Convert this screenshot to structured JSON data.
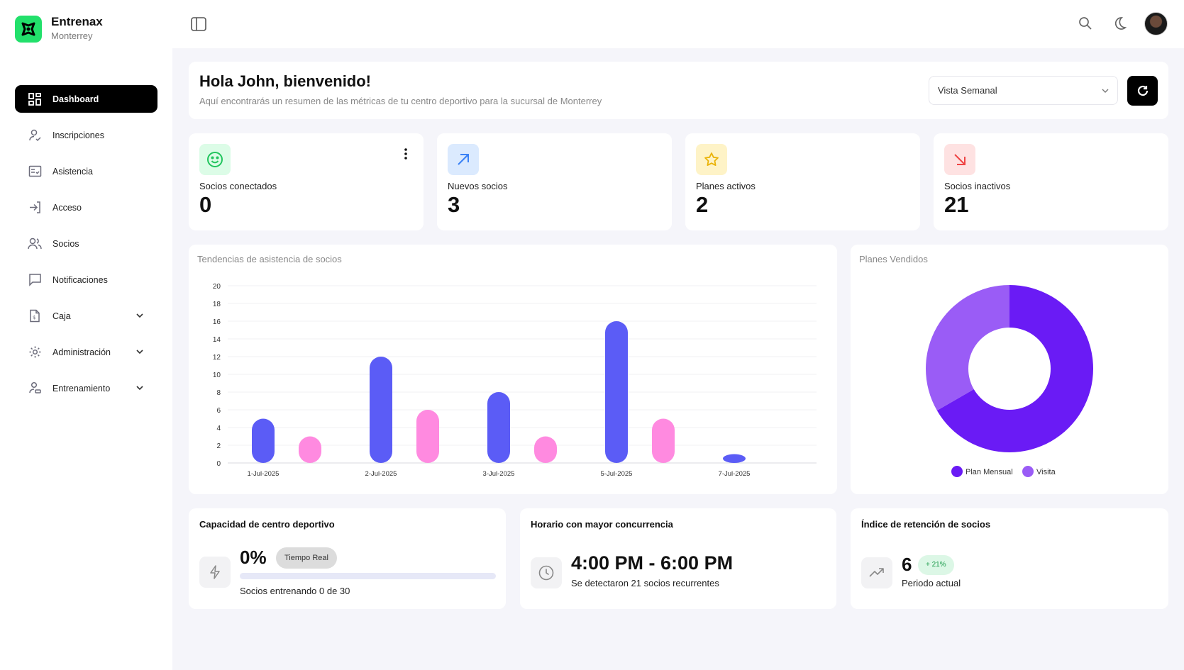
{
  "brand": {
    "name": "Entrenax",
    "location": "Monterrey",
    "accent": "#22e06b"
  },
  "sidebar": {
    "items": [
      {
        "label": "Dashboard",
        "icon": "dashboard-icon",
        "active": true
      },
      {
        "label": "Inscripciones",
        "icon": "user-check-icon"
      },
      {
        "label": "Asistencia",
        "icon": "checklist-icon"
      },
      {
        "label": "Acceso",
        "icon": "login-icon"
      },
      {
        "label": "Socios",
        "icon": "users-icon"
      },
      {
        "label": "Notificaciones",
        "icon": "message-icon"
      },
      {
        "label": "Caja",
        "icon": "receipt-icon",
        "expandable": true
      },
      {
        "label": "Administración",
        "icon": "gear-icon",
        "expandable": true
      },
      {
        "label": "Entrenamiento",
        "icon": "trainer-icon",
        "expandable": true
      }
    ]
  },
  "header": {
    "icons": [
      "sidebar-toggle-icon",
      "search-icon",
      "moon-icon",
      "avatar"
    ]
  },
  "welcome": {
    "title": "Hola John, bienvenido!",
    "subtitle": "Aquí encontrarás un resumen de las métricas de tu centro deportivo para la sucursal de Monterrey",
    "view_select": "Vista Semanal"
  },
  "stats": [
    {
      "label": "Socios conectados",
      "value": "0",
      "icon": "smile-icon",
      "color": "#22c55e",
      "bg": "#dcfce7"
    },
    {
      "label": "Nuevos socios",
      "value": "3",
      "icon": "arrow-up-right-icon",
      "color": "#3b82f6",
      "bg": "#dbeafe"
    },
    {
      "label": "Planes activos",
      "value": "2",
      "icon": "star-icon",
      "color": "#eab308",
      "bg": "#fef3c7"
    },
    {
      "label": "Socios inactivos",
      "value": "21",
      "icon": "arrow-down-right-icon",
      "color": "#ef4444",
      "bg": "#fee2e2"
    }
  ],
  "attendance_chart": {
    "title": "Tendencias de asistencia de socios"
  },
  "plans_chart": {
    "title": "Planes Vendidos"
  },
  "chart_data": [
    {
      "type": "bar",
      "title": "Tendencias de asistencia de socios",
      "categories": [
        "1-Jul-2025",
        "2-Jul-2025",
        "3-Jul-2025",
        "5-Jul-2025",
        "7-Jul-2025"
      ],
      "series": [
        {
          "values": [
            5,
            12,
            8,
            16,
            1
          ],
          "color": "#5b5cf6"
        },
        {
          "values": [
            3,
            6,
            3,
            5,
            0
          ],
          "color": "#ff8ae0"
        }
      ],
      "ylim": [
        0,
        20
      ],
      "yticks": [
        0,
        2,
        4,
        6,
        8,
        10,
        12,
        14,
        16,
        18,
        20
      ],
      "grid": true
    },
    {
      "type": "pie",
      "title": "Planes Vendidos",
      "labels": [
        "Plan Mensual",
        "Visita"
      ],
      "values": [
        2,
        1
      ],
      "colors": [
        "#6a1bf5",
        "#9a5cf6"
      ],
      "legend": "bottom"
    }
  ],
  "capacity": {
    "title": "Capacidad de centro deportivo",
    "percent": "0%",
    "badge": "Tiempo Real",
    "progress_fraction": 0,
    "text": "Socios entrenando 0 de 30"
  },
  "peak": {
    "title": "Horario con mayor concurrencia",
    "time": "4:00 PM - 6:00 PM",
    "text": "Se detectaron 21 socios recurrentes"
  },
  "retention": {
    "title": "Índice de retención de socios",
    "value": "6",
    "badge": "+ 21%",
    "text": "Periodo actual"
  }
}
